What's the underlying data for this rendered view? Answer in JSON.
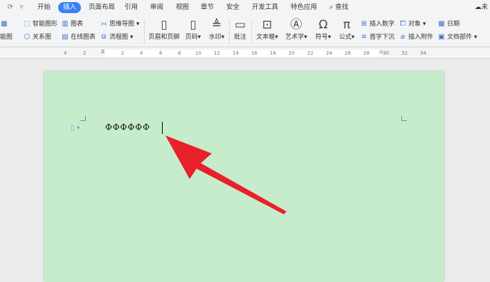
{
  "menubar": {
    "items": [
      "开始",
      "插入",
      "页面布局",
      "引用",
      "审阅",
      "视图",
      "章节",
      "安全",
      "开发工具",
      "特色应用"
    ],
    "active": "插入",
    "search_label": "查找",
    "right_label": "未"
  },
  "ribbon": {
    "col1": [
      "智能图形",
      "关系图"
    ],
    "col2": [
      "图表",
      "在线图表"
    ],
    "col3": [
      "思维导图",
      "流程图"
    ],
    "left_cut": "能图",
    "big": [
      "页眉和页脚",
      "页码",
      "水印",
      "批注",
      "文本框",
      "艺术字",
      "符号",
      "公式"
    ],
    "col4": [
      "插入数字",
      "首字下沉"
    ],
    "col5": [
      "对象",
      "插入附件"
    ],
    "col6": [
      "日期",
      "文档部件"
    ]
  },
  "ruler": {
    "ticks": [
      "4",
      "2",
      "2",
      "4",
      "6",
      "8",
      "10",
      "12",
      "14",
      "16",
      "18",
      "20",
      "22",
      "24",
      "26",
      "28",
      "30",
      "32",
      "34"
    ]
  },
  "document": {
    "text": "ΦΦΦΦΦΦ"
  },
  "colors": {
    "accent": "#3d7ff5",
    "page_background": "#c7eccb",
    "arrow": "#e8212a"
  }
}
